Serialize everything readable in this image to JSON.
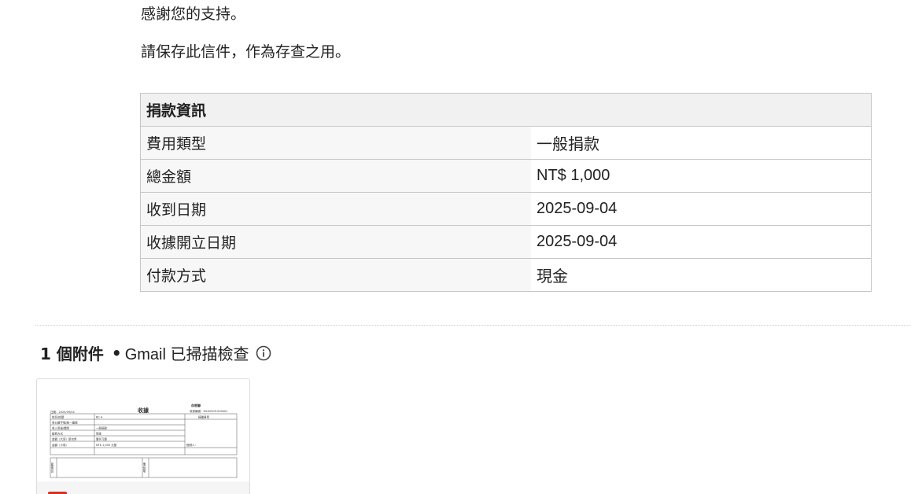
{
  "email": {
    "paragraphs": [
      "感謝您的支持。",
      "請保存此信件，作為存查之用。"
    ]
  },
  "donation_table": {
    "header": "捐款資訊",
    "rows": [
      {
        "label": "費用類型",
        "value": "一般捐款"
      },
      {
        "label": "總金額",
        "value": "NT$ 1,000"
      },
      {
        "label": "收到日期",
        "value": "2025-09-04"
      },
      {
        "label": "收據開立日期",
        "value": "2025-09-04"
      },
      {
        "label": "付款方式",
        "value": "現金"
      }
    ]
  },
  "attachments": {
    "count_label": "1 個附件",
    "separator": "•",
    "scan_label": "Gmail 已掃描檢查",
    "info_icon": "info-icon",
    "items": [
      {
        "type_icon": "pdf-icon",
        "badge_color": "#d93025",
        "preview": {
          "title": "收據",
          "stamp": "存根聯",
          "date": "日期：2025/09/04",
          "receipt_no": "收據編號：M202509-000001",
          "seal_label": "捐贈單章",
          "reviewer": "經辦人：",
          "rows": [
            {
              "label": "姓名/抬頭",
              "value": "BC A"
            },
            {
              "label": "身分證字號/統一編號",
              "value": ""
            },
            {
              "label": "收入用途/類別",
              "value": "一般捐款"
            },
            {
              "label": "繳費方式",
              "value": "現金"
            },
            {
              "label": "金額（大寫）新台幣",
              "value": "壹仟元整"
            },
            {
              "label": "金額（小寫）",
              "value": "NT$ 1,000 元整"
            }
          ],
          "footer_left": "新聞資訊",
          "footer_right": "備註說明"
        }
      }
    ]
  }
}
